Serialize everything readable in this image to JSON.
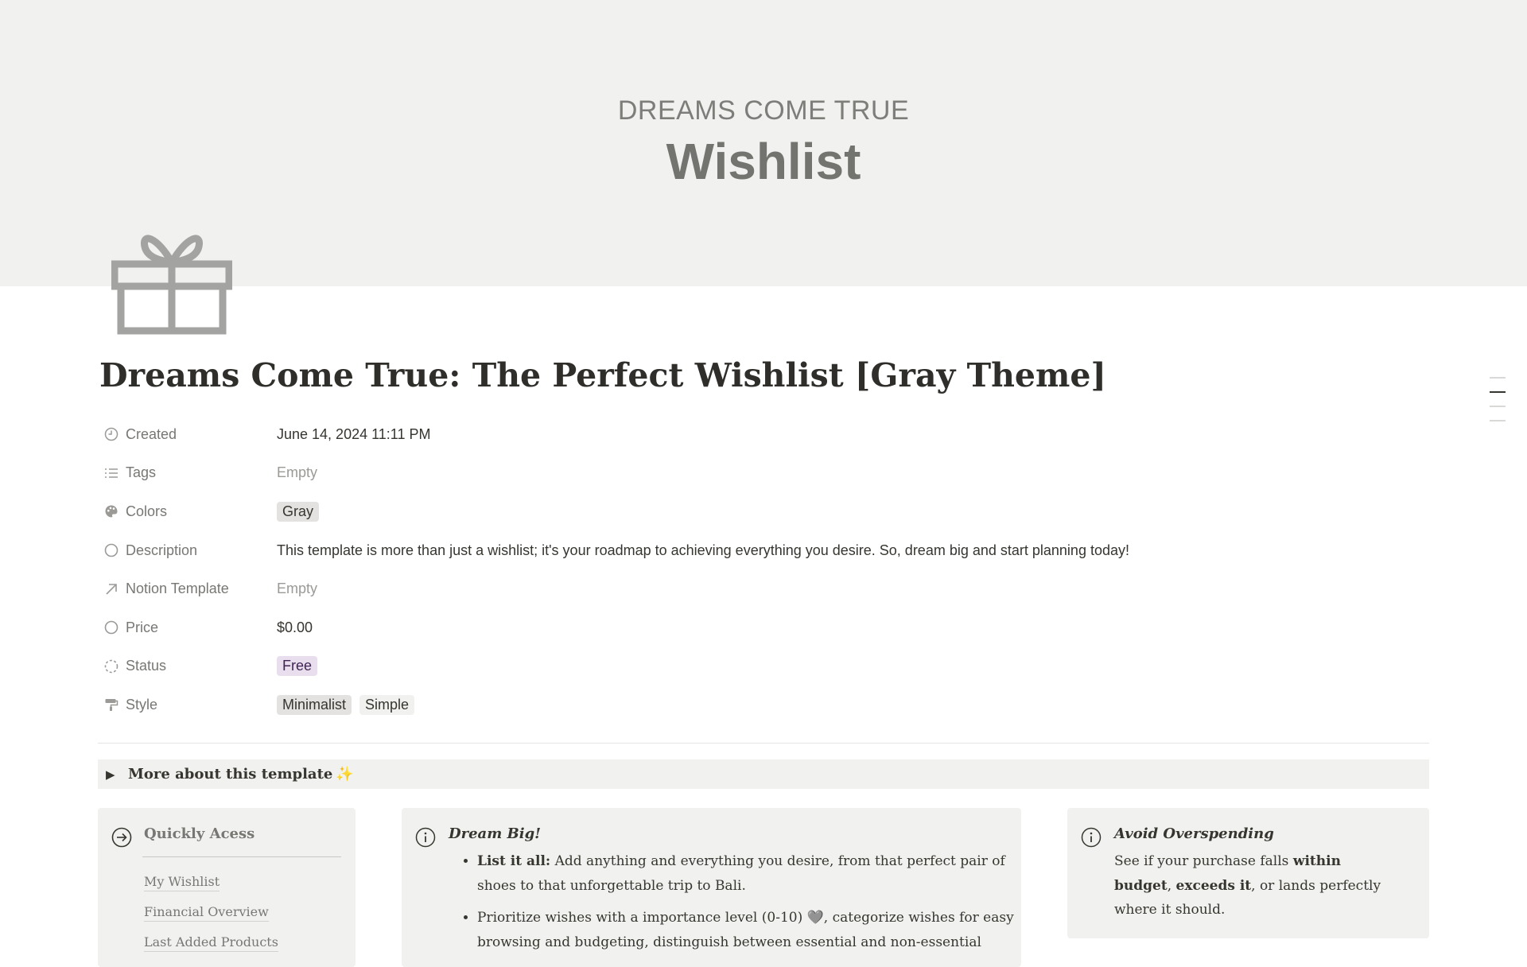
{
  "cover": {
    "subtitle": "DREAMS COME TRUE",
    "title": "Wishlist"
  },
  "page": {
    "title": "Dreams Come True: The Perfect Wishlist [Gray Theme]",
    "icon": "gift-icon"
  },
  "properties": {
    "created": {
      "label": "Created",
      "value": "June 14, 2024 11:11 PM",
      "icon": "clock-icon"
    },
    "tags": {
      "label": "Tags",
      "value": "Empty",
      "icon": "list-icon"
    },
    "colors": {
      "label": "Colors",
      "value": "Gray",
      "icon": "palette-icon"
    },
    "description": {
      "label": "Description",
      "value": "This template is more than just a wishlist; it's your roadmap to achieving everything you desire.  So, dream big and start planning today!",
      "icon": "circle-icon"
    },
    "notion_template": {
      "label": "Notion Template",
      "value": "Empty",
      "icon": "arrow-up-right-icon"
    },
    "price": {
      "label": "Price",
      "value": "$0.00",
      "icon": "circle-icon"
    },
    "status": {
      "label": "Status",
      "value": "Free",
      "icon": "dashed-circle-icon",
      "color": "#e8deee"
    },
    "style": {
      "label": "Style",
      "values": [
        "Minimalist",
        "Simple"
      ],
      "icon": "paint-roller-icon"
    }
  },
  "toggle": {
    "label": "More about this template",
    "emoji": "✨"
  },
  "quick_access": {
    "title": "Quickly Acess",
    "icon": "arrow-circle-right-icon",
    "links": [
      "My Wishlist",
      "Financial Overview",
      "Last Added Products"
    ]
  },
  "dream_big": {
    "title": "Dream Big!",
    "icon": "info-icon",
    "items": [
      {
        "bold": "List it all:",
        "text": " Add anything and everything you desire, from that perfect pair of shoes to that unforgettable trip to Bali."
      },
      {
        "bold": "",
        "text": "Prioritize wishes with a importance level (0-10) 🩶, categorize wishes for easy browsing and budgeting, distinguish between essential and non-essential"
      }
    ]
  },
  "avoid_overspending": {
    "title": "Avoid Overspending",
    "icon": "info-icon",
    "body_1": "See if your purchase falls ",
    "bold_1": "within budget",
    "body_2": ", ",
    "bold_2": "exceeds it",
    "body_3": ", or lands perfectly where it should."
  },
  "colors": {
    "accent_gray": "#f1f1ef",
    "status_purple": "#e8deee",
    "text": "#37352f"
  }
}
